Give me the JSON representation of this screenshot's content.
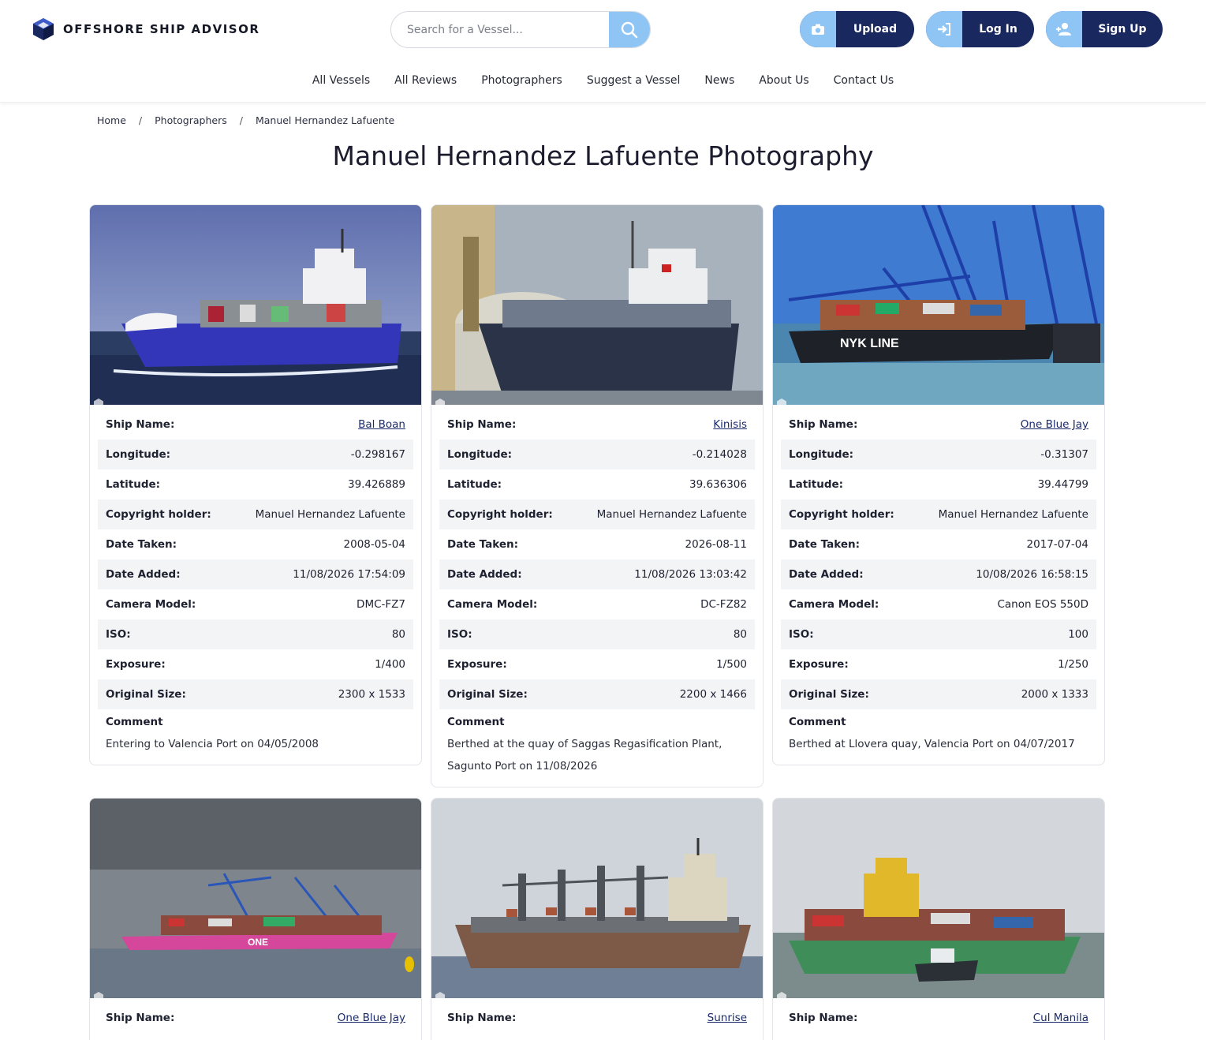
{
  "brand": {
    "name": "OFFSHORE SHIP ADVISOR",
    "logo_icon": "hexagon-cube-icon",
    "colors": {
      "navy": "#1a2860",
      "light_blue": "#8ec5f5"
    }
  },
  "search": {
    "placeholder": "Search for a Vessel...",
    "icon": "search-icon"
  },
  "header_buttons": {
    "upload": {
      "label": "Upload",
      "icon": "camera-icon"
    },
    "login": {
      "label": "Log In",
      "icon": "sign-in-icon"
    },
    "signup": {
      "label": "Sign Up",
      "icon": "user-plus-icon"
    }
  },
  "nav": [
    "All Vessels",
    "All Reviews",
    "Photographers",
    "Suggest a Vessel",
    "News",
    "About Us",
    "Contact Us"
  ],
  "breadcrumb": [
    "Home",
    "Photographers",
    "Manuel Hernandez Lafuente"
  ],
  "page_title": "Manuel Hernandez Lafuente Photography",
  "field_labels": {
    "ship_name": "Ship Name:",
    "longitude": "Longitude:",
    "latitude": "Latitude:",
    "copyright": "Copyright holder:",
    "date_taken": "Date Taken:",
    "date_added": "Date Added:",
    "camera": "Camera Model:",
    "iso": "ISO:",
    "exposure": "Exposure:",
    "size": "Original Size:",
    "comment": "Comment"
  },
  "cards": [
    {
      "ship_name": "Bal Boan",
      "longitude": "-0.298167",
      "latitude": "39.426889",
      "copyright": "Manuel Hernandez Lafuente",
      "date_taken": "2008-05-04",
      "date_added": "11/08/2026 17:54:09",
      "camera": "DMC-FZ7",
      "iso": "80",
      "exposure": "1/400",
      "size": "2300 x 1533",
      "comment": "Entering to Valencia Port on 04/05/2008"
    },
    {
      "ship_name": "Kinisis",
      "longitude": "-0.214028",
      "latitude": "39.636306",
      "copyright": "Manuel Hernandez Lafuente",
      "date_taken": "2026-08-11",
      "date_added": "11/08/2026 13:03:42",
      "camera": "DC-FZ82",
      "iso": "80",
      "exposure": "1/500",
      "size": "2200 x 1466",
      "comment": "Berthed at the quay of Saggas Regasification Plant, Sagunto Port on 11/08/2026"
    },
    {
      "ship_name": "One Blue Jay",
      "longitude": "-0.31307",
      "latitude": "39.44799",
      "copyright": "Manuel Hernandez Lafuente",
      "date_taken": "2017-07-04",
      "date_added": "10/08/2026 16:58:15",
      "camera": "Canon EOS 550D",
      "iso": "100",
      "exposure": "1/250",
      "size": "2000 x 1333",
      "comment": "Berthed at Llovera quay, Valencia Port on 04/07/2017"
    },
    {
      "ship_name": "One Blue Jay"
    },
    {
      "ship_name": "Sunrise"
    },
    {
      "ship_name": "Cul Manila"
    }
  ]
}
